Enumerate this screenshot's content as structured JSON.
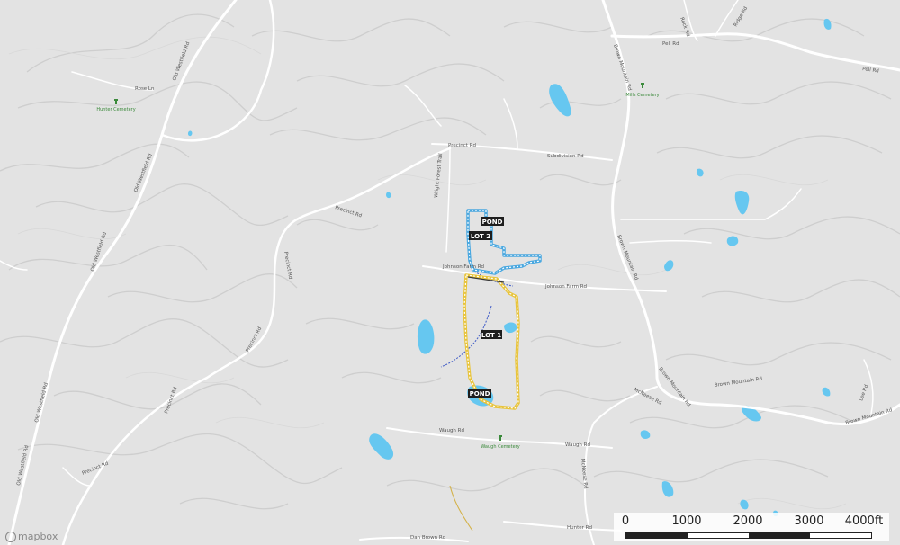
{
  "roads": {
    "pell": "Pell Rd",
    "pell_east": "Pell Rd",
    "brown_mountain_n": "Brown Mountain Rd",
    "brown_mountain_mid": "Brown Mountain Rd",
    "brown_mountain_s": "Brown Mountain Rd",
    "brown_mountain_se": "Brown Mountain Rd",
    "old_westfield_1": "Old Westfield Rd",
    "old_westfield_2": "Old Westfield Rd",
    "old_westfield_3": "Old Westfield Rd",
    "old_westfield_4": "Old Westfield Rd",
    "precinct_n": "Precinct Rd",
    "precinct_w": "Precinct Rd",
    "precinct_mid": "Precinct Rd",
    "precinct_s": "Precinct Rd",
    "precinct_sw": "Precinct Rd",
    "subdivision": "Subdivision Rd",
    "johnson_farm_w": "Johnson Farm Rd",
    "johnson_farm_e": "Johnson Farm Rd",
    "waugh_w": "Waugh Rd",
    "waugh_e": "Waugh Rd",
    "mcneese": "McNeese Rd",
    "mcneese_s": "McNeese Rd",
    "hunter": "Hunter Rd",
    "dan_brown": "Dan Brown Rd",
    "rose_ln": "Rose Ln",
    "lee_rd": "Lee Rd",
    "rock_rd": "Rock Rd",
    "ridge_rd": "Ridge Rd",
    "wright_forest": "Wright Forest Trail"
  },
  "places": {
    "hunter_cemetery": "Hunter Cemetery",
    "mills_cemetery": "Mills Cemetery",
    "waugh_cemetery": "Waugh Cemetery"
  },
  "labels": {
    "pond_north": "POND",
    "lot2": "LOT 2",
    "lot1": "LOT 1",
    "pond_south": "POND"
  },
  "scale": {
    "ticks": [
      "0",
      "1000",
      "2000",
      "3000",
      "4000ft"
    ]
  },
  "attribution": "mapbox",
  "colors": {
    "background": "#e3e3e3",
    "road": "#ffffff",
    "contour": "#cfcfcf",
    "water": "#66c7f0",
    "lot2_boundary": "#4aa8e0",
    "lot1_boundary": "#e8c43c",
    "cemetery": "#3b8a3b"
  }
}
